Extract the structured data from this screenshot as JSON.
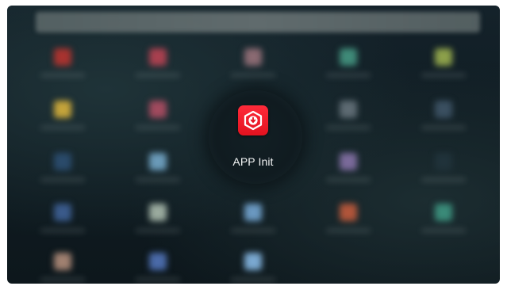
{
  "launcher": {
    "focused_app": {
      "label": "APP Init",
      "icon": "hexagon-download-icon",
      "icon_color": "#ee1b2a"
    },
    "background_tiles": [
      {
        "color": "#a8332f"
      },
      {
        "color": "#a8404f"
      },
      {
        "color": "#8a6a72"
      },
      {
        "color": "#3f8a78"
      },
      {
        "color": "#8ca04a"
      },
      {
        "color": "#c4a33a"
      },
      {
        "color": "#a04a5e"
      },
      {
        "color": "#5d6a72"
      },
      {
        "color": "#3a4f60"
      },
      {
        "color": "#2a4a6a"
      },
      {
        "color": "#6a9ab8"
      },
      {
        "color": "#7a6a9a"
      },
      {
        "color": "#20323a"
      },
      {
        "color": "#3a5a8a"
      },
      {
        "color": "#9aaa9e"
      },
      {
        "color": "#6a98c0"
      },
      {
        "color": "#b0553a"
      },
      {
        "color": "#3a8a78"
      },
      {
        "color": "#a08070"
      },
      {
        "color": "#4a6aa8"
      },
      {
        "color": "#7aa8d0"
      },
      {
        "color": "#6a8ad0"
      },
      {
        "color": "#c04a30"
      }
    ]
  }
}
